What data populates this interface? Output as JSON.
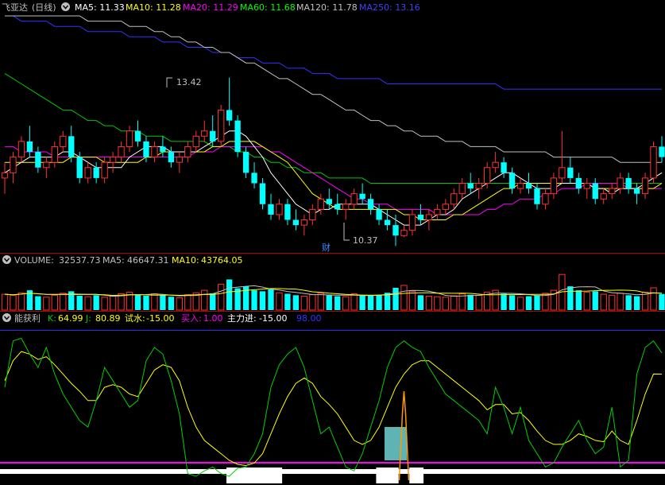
{
  "stock_name": "飞亚达",
  "period": "(日线)",
  "ma": [
    {
      "name": "MA5:",
      "value": "11.33",
      "color": "#ffffff"
    },
    {
      "name": "MA10:",
      "value": "11.28",
      "color": "#ffff00"
    },
    {
      "name": "MA20:",
      "value": "11.29",
      "color": "#ff00ff"
    },
    {
      "name": "MA60:",
      "value": "11.68",
      "color": "#00ff00"
    },
    {
      "name": "MA120:",
      "value": "11.78",
      "color": "#c0c0c0"
    },
    {
      "name": "MA250:",
      "value": "13.16",
      "color": "#4040ff"
    }
  ],
  "price_high_label": "13.42",
  "price_low_label": "10.37",
  "caishi_marker": "财",
  "volume_panel": {
    "title": "VOLUME:",
    "value": "32537.73",
    "ma5_label": "MA5:",
    "ma5_value": "46647.31",
    "ma10_label": "MA10:",
    "ma10_value": "43764.05"
  },
  "indicator_panel": {
    "title": "能获利",
    "k_label": "K:",
    "k_value": "64.99",
    "j_label": "J:",
    "j_value": "80.89",
    "shishui_label": "试水:",
    "shishui_value": "-15.00",
    "mairu_label": "买入:",
    "mairu_value": "1.00",
    "zhuli_label": "主力进:",
    "zhuli_value": "-15.00",
    "level_value": "98.00"
  },
  "colors": {
    "up": "#ff3232",
    "down": "#00ffff",
    "ma5": "#ffffff",
    "ma10": "#ffff00",
    "ma20": "#ff00ff",
    "ma60": "#00c800",
    "ma120": "#c0c0c0",
    "ma250": "#3232ff",
    "separator": "#c00000",
    "j_line": "#00d000",
    "k_line": "#ffff00",
    "shishui_bar": "#5fb3b3",
    "orange": "#ff9900"
  },
  "chart_data": {
    "type": "line",
    "price": {
      "ylim": [
        10.1,
        14.6
      ],
      "candles": [
        [
          11.5,
          11.8,
          11.2,
          11.6
        ],
        [
          11.6,
          12.0,
          11.4,
          11.9
        ],
        [
          11.9,
          12.3,
          11.8,
          12.2
        ],
        [
          12.2,
          12.5,
          11.9,
          12.0
        ],
        [
          12.0,
          12.1,
          11.6,
          11.7
        ],
        [
          11.7,
          11.9,
          11.5,
          11.8
        ],
        [
          11.8,
          12.2,
          11.7,
          12.1
        ],
        [
          12.1,
          12.4,
          12.0,
          12.3
        ],
        [
          12.3,
          12.5,
          11.8,
          11.9
        ],
        [
          11.9,
          12.0,
          11.4,
          11.5
        ],
        [
          11.5,
          11.8,
          11.4,
          11.7
        ],
        [
          11.7,
          11.8,
          11.4,
          11.5
        ],
        [
          11.5,
          11.9,
          11.4,
          11.8
        ],
        [
          11.8,
          12.0,
          11.6,
          11.9
        ],
        [
          11.9,
          12.2,
          11.8,
          12.1
        ],
        [
          12.1,
          12.5,
          12.0,
          12.4
        ],
        [
          12.4,
          12.6,
          12.1,
          12.2
        ],
        [
          12.2,
          12.3,
          11.8,
          11.9
        ],
        [
          11.9,
          12.2,
          11.8,
          12.1
        ],
        [
          12.1,
          12.3,
          11.9,
          12.0
        ],
        [
          12.0,
          12.1,
          11.7,
          11.8
        ],
        [
          11.8,
          12.0,
          11.6,
          11.9
        ],
        [
          11.9,
          12.2,
          11.8,
          12.1
        ],
        [
          12.1,
          12.4,
          12.0,
          12.3
        ],
        [
          12.3,
          12.6,
          12.2,
          12.4
        ],
        [
          12.4,
          12.7,
          12.1,
          12.2
        ],
        [
          12.2,
          12.9,
          12.1,
          12.8
        ],
        [
          12.8,
          13.42,
          12.5,
          12.6
        ],
        [
          12.6,
          12.7,
          11.9,
          12.0
        ],
        [
          12.0,
          12.1,
          11.5,
          11.6
        ],
        [
          11.6,
          11.8,
          11.3,
          11.4
        ],
        [
          11.4,
          11.5,
          10.9,
          11.0
        ],
        [
          11.0,
          11.2,
          10.7,
          10.8
        ],
        [
          10.8,
          11.1,
          10.7,
          11.0
        ],
        [
          11.0,
          11.1,
          10.6,
          10.7
        ],
        [
          10.7,
          10.9,
          10.5,
          10.6
        ],
        [
          10.6,
          10.8,
          10.4,
          10.7
        ],
        [
          10.7,
          11.0,
          10.6,
          10.9
        ],
        [
          10.9,
          11.2,
          10.8,
          11.1
        ],
        [
          11.1,
          11.3,
          10.9,
          11.0
        ],
        [
          11.0,
          11.2,
          10.8,
          10.9
        ],
        [
          10.9,
          11.1,
          10.7,
          11.0
        ],
        [
          11.0,
          11.3,
          10.9,
          11.2
        ],
        [
          11.2,
          11.4,
          11.0,
          11.1
        ],
        [
          11.1,
          11.2,
          10.8,
          10.9
        ],
        [
          10.9,
          11.0,
          10.6,
          10.7
        ],
        [
          10.7,
          10.9,
          10.5,
          10.6
        ],
        [
          10.6,
          10.8,
          10.2,
          10.4
        ],
        [
          10.4,
          10.6,
          10.37,
          10.5
        ],
        [
          10.5,
          10.9,
          10.4,
          10.8
        ],
        [
          10.8,
          11.0,
          10.6,
          10.7
        ],
        [
          10.7,
          10.9,
          10.5,
          10.8
        ],
        [
          10.8,
          11.0,
          10.7,
          10.9
        ],
        [
          10.9,
          11.1,
          10.8,
          11.0
        ],
        [
          11.0,
          11.3,
          10.9,
          11.2
        ],
        [
          11.2,
          11.5,
          11.1,
          11.4
        ],
        [
          11.4,
          11.6,
          11.2,
          11.3
        ],
        [
          11.3,
          11.5,
          11.1,
          11.4
        ],
        [
          11.4,
          11.8,
          11.3,
          11.7
        ],
        [
          11.7,
          12.0,
          11.6,
          11.8
        ],
        [
          11.8,
          11.9,
          11.5,
          11.6
        ],
        [
          11.6,
          11.7,
          11.2,
          11.3
        ],
        [
          11.3,
          11.5,
          11.2,
          11.4
        ],
        [
          11.4,
          11.6,
          11.2,
          11.3
        ],
        [
          11.3,
          11.4,
          10.9,
          11.0
        ],
        [
          11.0,
          11.3,
          10.9,
          11.2
        ],
        [
          11.2,
          11.6,
          11.1,
          11.5
        ],
        [
          11.5,
          12.4,
          11.4,
          11.7
        ],
        [
          11.7,
          11.9,
          11.4,
          11.5
        ],
        [
          11.5,
          11.6,
          11.2,
          11.3
        ],
        [
          11.3,
          11.5,
          11.1,
          11.4
        ],
        [
          11.4,
          11.5,
          11.0,
          11.1
        ],
        [
          11.1,
          11.3,
          11.0,
          11.2
        ],
        [
          11.2,
          11.4,
          11.1,
          11.3
        ],
        [
          11.3,
          11.6,
          11.2,
          11.5
        ],
        [
          11.5,
          11.6,
          11.2,
          11.3
        ],
        [
          11.3,
          11.4,
          11.0,
          11.2
        ],
        [
          11.2,
          11.6,
          11.1,
          11.5
        ],
        [
          11.5,
          12.2,
          11.4,
          12.1
        ],
        [
          12.1,
          12.3,
          11.8,
          11.9
        ]
      ],
      "ma5": [
        11.6,
        11.7,
        11.8,
        11.9,
        11.9,
        11.9,
        11.9,
        12.0,
        12.0,
        11.9,
        11.8,
        11.7,
        11.7,
        11.7,
        11.7,
        11.9,
        12.0,
        12.1,
        12.1,
        12.1,
        12.0,
        12.0,
        12.0,
        12.0,
        12.1,
        12.2,
        12.3,
        12.4,
        12.4,
        12.3,
        12.1,
        11.9,
        11.6,
        11.4,
        11.2,
        11.0,
        10.9,
        10.8,
        10.9,
        10.9,
        11.0,
        11.0,
        11.0,
        11.0,
        11.0,
        10.9,
        10.8,
        10.7,
        10.6,
        10.6,
        10.6,
        10.7,
        10.8,
        10.8,
        10.9,
        11.1,
        11.2,
        11.3,
        11.4,
        11.5,
        11.6,
        11.6,
        11.5,
        11.4,
        11.3,
        11.3,
        11.3,
        11.4,
        11.4,
        11.4,
        11.4,
        11.3,
        11.3,
        11.2,
        11.3,
        11.3,
        11.3,
        11.4,
        11.5,
        11.6
      ],
      "ma10": [
        11.8,
        11.8,
        11.8,
        11.8,
        11.8,
        11.8,
        11.8,
        11.8,
        11.9,
        11.9,
        11.9,
        11.9,
        11.8,
        11.8,
        11.8,
        11.8,
        11.8,
        11.9,
        11.9,
        12.0,
        12.0,
        12.0,
        12.0,
        12.0,
        12.0,
        12.1,
        12.1,
        12.2,
        12.2,
        12.2,
        12.2,
        12.1,
        12.0,
        11.9,
        11.8,
        11.6,
        11.4,
        11.2,
        11.1,
        11.0,
        10.9,
        10.9,
        10.9,
        10.9,
        10.9,
        10.9,
        10.9,
        10.9,
        10.8,
        10.8,
        10.7,
        10.7,
        10.7,
        10.7,
        10.8,
        10.8,
        10.9,
        11.0,
        11.1,
        11.2,
        11.3,
        11.3,
        11.4,
        11.4,
        11.4,
        11.4,
        11.4,
        11.4,
        11.4,
        11.4,
        11.4,
        11.3,
        11.3,
        11.3,
        11.3,
        11.3,
        11.3,
        11.3,
        11.3,
        11.4
      ],
      "ma20": [
        12.1,
        12.1,
        12.0,
        12.0,
        12.0,
        12.0,
        11.9,
        11.9,
        11.9,
        11.9,
        11.9,
        11.9,
        11.9,
        11.9,
        11.9,
        11.9,
        11.9,
        11.9,
        11.9,
        11.9,
        11.9,
        11.9,
        11.9,
        12.0,
        12.0,
        12.0,
        12.1,
        12.1,
        12.1,
        12.1,
        12.1,
        12.1,
        12.0,
        12.0,
        11.9,
        11.8,
        11.7,
        11.6,
        11.5,
        11.4,
        11.3,
        11.2,
        11.1,
        11.1,
        11.0,
        11.0,
        11.0,
        10.9,
        10.9,
        10.9,
        10.9,
        10.9,
        10.8,
        10.8,
        10.8,
        10.8,
        10.8,
        10.8,
        10.9,
        10.9,
        11.0,
        11.0,
        11.1,
        11.1,
        11.1,
        11.2,
        11.2,
        11.3,
        11.3,
        11.3,
        11.4,
        11.4,
        11.4,
        11.4,
        11.4,
        11.3,
        11.3,
        11.3,
        11.3,
        11.3
      ],
      "ma60": [
        13.5,
        13.4,
        13.3,
        13.2,
        13.1,
        13.0,
        12.9,
        12.8,
        12.8,
        12.7,
        12.6,
        12.6,
        12.5,
        12.5,
        12.4,
        12.4,
        12.4,
        12.3,
        12.3,
        12.3,
        12.2,
        12.2,
        12.2,
        12.2,
        12.2,
        12.1,
        12.1,
        12.1,
        12.0,
        12.0,
        11.9,
        11.9,
        11.8,
        11.8,
        11.7,
        11.7,
        11.6,
        11.6,
        11.6,
        11.5,
        11.5,
        11.5,
        11.5,
        11.5,
        11.4,
        11.4,
        11.4,
        11.4,
        11.4,
        11.4,
        11.4,
        11.4,
        11.4,
        11.4,
        11.4,
        11.4,
        11.4,
        11.4,
        11.4,
        11.4,
        11.4,
        11.4,
        11.4,
        11.4,
        11.4,
        11.4,
        11.4,
        11.4,
        11.4,
        11.4,
        11.4,
        11.4,
        11.4,
        11.4,
        11.4,
        11.4,
        11.4,
        11.4,
        11.4,
        11.4
      ],
      "ma120": [
        14.6,
        14.6,
        14.6,
        14.6,
        14.6,
        14.6,
        14.6,
        14.6,
        14.6,
        14.6,
        14.5,
        14.5,
        14.5,
        14.5,
        14.5,
        14.4,
        14.4,
        14.4,
        14.3,
        14.3,
        14.2,
        14.2,
        14.1,
        14.1,
        14.0,
        14.0,
        13.9,
        13.9,
        13.8,
        13.7,
        13.7,
        13.6,
        13.5,
        13.4,
        13.4,
        13.3,
        13.2,
        13.1,
        13.1,
        13.0,
        12.9,
        12.8,
        12.8,
        12.7,
        12.6,
        12.6,
        12.5,
        12.5,
        12.4,
        12.4,
        12.3,
        12.3,
        12.3,
        12.2,
        12.2,
        12.2,
        12.1,
        12.1,
        12.1,
        12.1,
        12.0,
        12.0,
        12.0,
        12.0,
        12.0,
        12.0,
        11.9,
        11.9,
        11.9,
        11.9,
        11.9,
        11.9,
        11.9,
        11.9,
        11.8,
        11.8,
        11.8,
        11.8,
        11.8,
        11.8
      ],
      "ma250": [
        14.6,
        14.6,
        14.5,
        14.5,
        14.5,
        14.5,
        14.4,
        14.4,
        14.4,
        14.4,
        14.3,
        14.3,
        14.3,
        14.3,
        14.3,
        14.2,
        14.2,
        14.2,
        14.2,
        14.1,
        14.1,
        14.1,
        14.0,
        14.0,
        14.0,
        13.9,
        13.9,
        13.9,
        13.8,
        13.8,
        13.8,
        13.7,
        13.7,
        13.7,
        13.6,
        13.6,
        13.6,
        13.5,
        13.5,
        13.5,
        13.4,
        13.4,
        13.4,
        13.4,
        13.4,
        13.4,
        13.3,
        13.3,
        13.3,
        13.3,
        13.3,
        13.3,
        13.3,
        13.3,
        13.3,
        13.3,
        13.3,
        13.3,
        13.3,
        13.3,
        13.2,
        13.2,
        13.2,
        13.2,
        13.2,
        13.2,
        13.2,
        13.2,
        13.2,
        13.2,
        13.2,
        13.2,
        13.2,
        13.2,
        13.2,
        13.2,
        13.2,
        13.2,
        13.2,
        13.2
      ]
    },
    "volume": {
      "ylim": [
        0,
        90000
      ],
      "values": [
        32000,
        30000,
        35000,
        40000,
        28000,
        26000,
        30000,
        34000,
        38000,
        29000,
        27000,
        30000,
        26000,
        28000,
        33000,
        36000,
        31000,
        29000,
        33000,
        30000,
        27000,
        25000,
        31000,
        35000,
        40000,
        34000,
        52000,
        62000,
        44000,
        48000,
        40000,
        38000,
        42000,
        35000,
        33000,
        30000,
        28000,
        31000,
        34000,
        30000,
        28000,
        27000,
        33000,
        29000,
        30000,
        31000,
        35000,
        45000,
        50000,
        38000,
        30000,
        28000,
        27000,
        26000,
        29000,
        33000,
        31000,
        30000,
        36000,
        40000,
        33000,
        30000,
        26000,
        28000,
        30000,
        34000,
        40000,
        72000,
        48000,
        40000,
        36000,
        38000,
        32000,
        30000,
        34000,
        30000,
        28000,
        36000,
        45000,
        32537.73
      ],
      "up": [
        1,
        1,
        1,
        0,
        0,
        1,
        1,
        1,
        0,
        0,
        1,
        0,
        1,
        1,
        1,
        1,
        0,
        0,
        1,
        0,
        0,
        1,
        1,
        1,
        1,
        0,
        1,
        0,
        0,
        0,
        0,
        0,
        0,
        1,
        0,
        0,
        1,
        1,
        1,
        0,
        0,
        1,
        1,
        0,
        0,
        0,
        0,
        0,
        1,
        1,
        0,
        1,
        1,
        1,
        1,
        1,
        0,
        1,
        1,
        1,
        0,
        0,
        1,
        0,
        0,
        1,
        1,
        1,
        0,
        0,
        1,
        0,
        1,
        1,
        1,
        0,
        0,
        1,
        1,
        0
      ]
    },
    "indicator": {
      "ylim": [
        -15,
        100
      ],
      "level": 98,
      "J": [
        55,
        90,
        92,
        80,
        70,
        85,
        65,
        50,
        40,
        30,
        25,
        45,
        70,
        60,
        50,
        40,
        45,
        75,
        85,
        80,
        60,
        35,
        -10,
        -12,
        -8,
        -5,
        -10,
        -12,
        -6,
        -5,
        5,
        20,
        55,
        72,
        80,
        85,
        70,
        45,
        20,
        25,
        10,
        -5,
        -8,
        5,
        25,
        45,
        70,
        85,
        90,
        85,
        82,
        70,
        60,
        50,
        45,
        40,
        35,
        30,
        20,
        55,
        40,
        20,
        40,
        15,
        5,
        -5,
        -2,
        10,
        20,
        30,
        15,
        5,
        10,
        40,
        -5,
        0,
        65,
        85,
        90,
        80.89
      ],
      "K": [
        60,
        75,
        82,
        80,
        76,
        78,
        72,
        65,
        58,
        52,
        45,
        45,
        55,
        57,
        55,
        50,
        48,
        58,
        68,
        72,
        70,
        60,
        40,
        25,
        15,
        10,
        5,
        0,
        -3,
        -4,
        -2,
        5,
        20,
        35,
        48,
        58,
        62,
        58,
        48,
        42,
        35,
        25,
        15,
        12,
        15,
        25,
        40,
        55,
        65,
        72,
        75,
        75,
        70,
        65,
        60,
        55,
        50,
        45,
        38,
        42,
        42,
        35,
        36,
        30,
        22,
        15,
        12,
        12,
        15,
        20,
        18,
        15,
        14,
        22,
        15,
        12,
        30,
        50,
        65,
        64.99
      ],
      "shishui": [
        {
          "x": 47,
          "v": -15
        }
      ],
      "orange_spike": [
        {
          "x": 48,
          "h": 1
        }
      ],
      "zhuli_bars": [
        [
          27,
          33,
          -15
        ],
        [
          45,
          47,
          -15
        ],
        [
          49,
          50,
          -15
        ]
      ],
      "bottom_band": [
        [
          0,
          79,
          -15
        ]
      ]
    }
  }
}
